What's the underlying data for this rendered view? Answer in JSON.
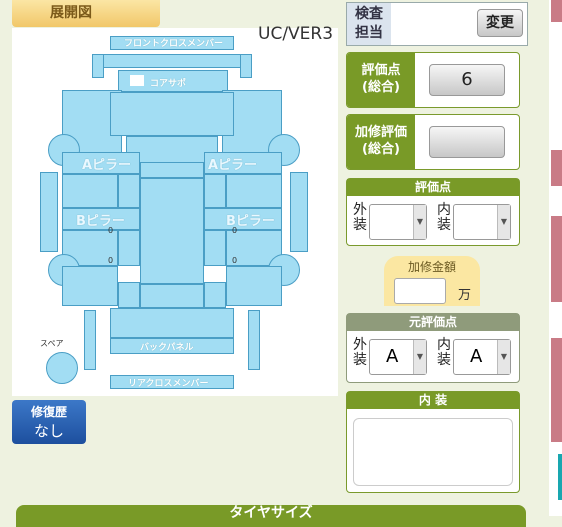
{
  "diagram": {
    "tab_title": "展開図",
    "version": "UC/VER3",
    "labels": {
      "front_cross_member": "フロントクロスメンバー",
      "core_support": "コアサポ",
      "a_pillar_left": "Aピラー",
      "a_pillar_right": "Aピラー",
      "b_pillar_left": "Bピラー",
      "b_pillar_right": "Bピラー",
      "back_panel": "バックパネル",
      "rear_cross_member": "リアクロスメンバー",
      "spare": "スペア",
      "zero_marks": [
        "0",
        "0",
        "0",
        "0"
      ]
    }
  },
  "repair_history": {
    "title": "修復歴",
    "value": "なし"
  },
  "inspector": {
    "label_line1": "検査",
    "label_line2": "担当",
    "change_button": "変更"
  },
  "overall_score": {
    "label_line1": "評価点",
    "label_line2": "(総合)",
    "value": "6"
  },
  "repair_score": {
    "label_line1": "加修評価",
    "label_line2": "(総合)",
    "value": ""
  },
  "score": {
    "header": "評価点",
    "exterior_label_1": "外",
    "exterior_label_2": "装",
    "exterior_value": "",
    "interior_label_1": "内",
    "interior_label_2": "装",
    "interior_value": ""
  },
  "repair_cost": {
    "label": "加修金額",
    "value": "",
    "unit": "万"
  },
  "original_score": {
    "header": "元評価点",
    "exterior_label_1": "外",
    "exterior_label_2": "装",
    "exterior_value": "A",
    "interior_label_1": "内",
    "interior_label_2": "装",
    "interior_value": "A"
  },
  "interior_section": {
    "header": "内 装",
    "text": ""
  },
  "bottom": {
    "title": "タイヤサイズ"
  },
  "colors": {
    "accent_green": "#799a27",
    "part_blue": "#a2ddf3",
    "repair_blue": "#1d4f9e"
  }
}
